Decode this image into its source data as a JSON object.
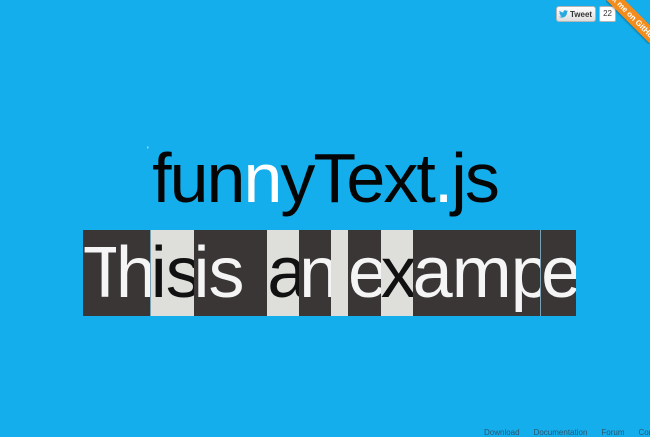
{
  "tweet": {
    "label": "Tweet",
    "count": "22",
    "icon": "twitter-bird-icon"
  },
  "ribbon": {
    "label": "Fork me on GitHub",
    "color": "#f28c1c"
  },
  "title": {
    "part1": "fun",
    "part2": "n",
    "part3": "yText",
    "part4": ".",
    "part5": "js",
    "mark": "'"
  },
  "example": {
    "text": "This is an example",
    "cells": [
      {
        "text": "T",
        "tone": "dark"
      },
      {
        "text": "h",
        "tone": "dark"
      },
      {
        "text": "is",
        "tone": "light"
      },
      {
        "text": " is ",
        "tone": "dark"
      },
      {
        "text": "a",
        "tone": "light"
      },
      {
        "text": "n",
        "tone": "dark"
      },
      {
        "text": " ",
        "tone": "light"
      },
      {
        "text": "e",
        "tone": "dark"
      },
      {
        "text": "x",
        "tone": "light"
      },
      {
        "text": "ampl",
        "tone": "dark"
      },
      {
        "text": "e",
        "tone": "dark"
      }
    ]
  },
  "footer": {
    "links": [
      "Download",
      "Documentation",
      "Forum",
      "Contact"
    ]
  },
  "colors": {
    "background": "#15aeec",
    "dark_cell": "#3a3636",
    "light_cell": "#dededa"
  }
}
